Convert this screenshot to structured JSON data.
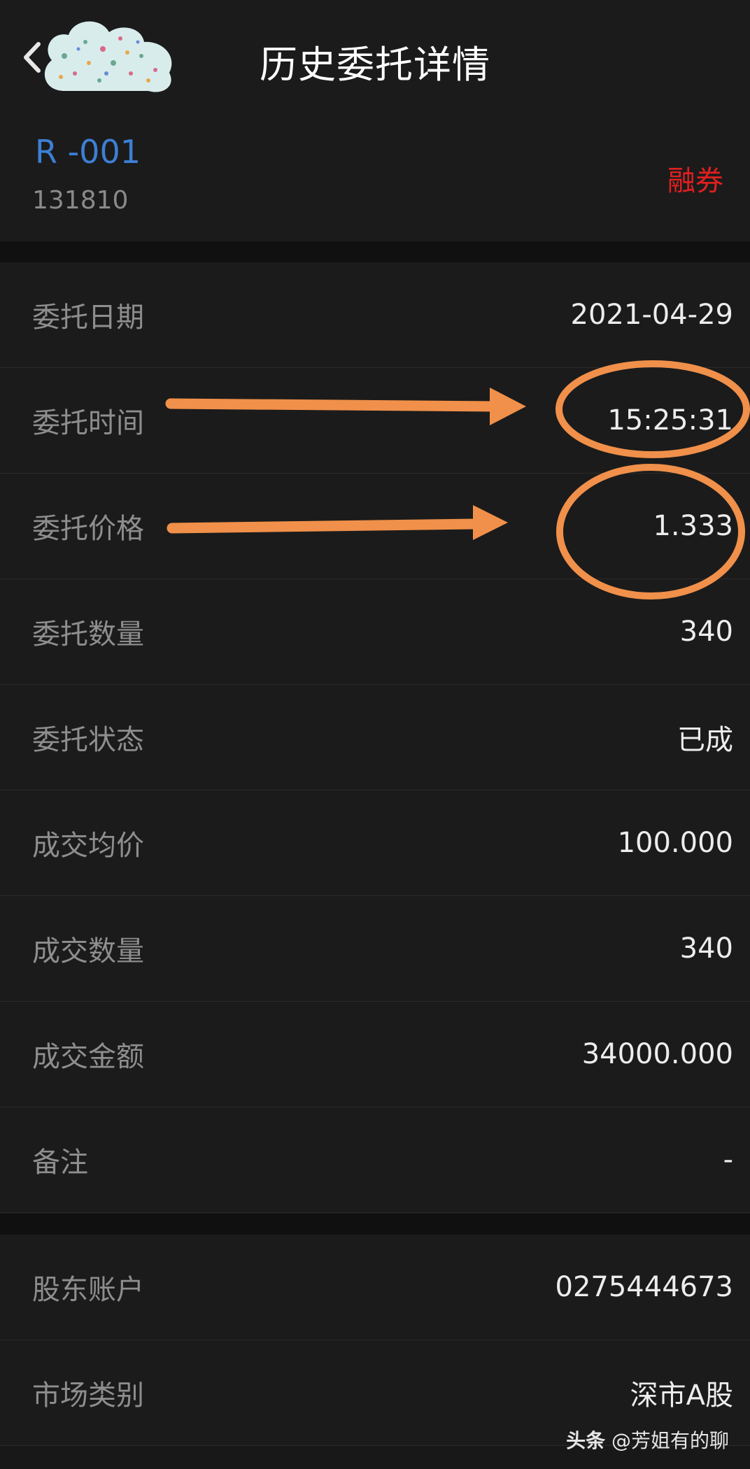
{
  "header": {
    "title": "历史委托详情",
    "back_icon": "chevron-left-icon"
  },
  "security": {
    "name": "R -001",
    "code": "131810",
    "trade_type": "融券"
  },
  "details": [
    {
      "label": "委托日期",
      "value": "2021-04-29"
    },
    {
      "label": "委托时间",
      "value": "15:25:31"
    },
    {
      "label": "委托价格",
      "value": "1.333"
    },
    {
      "label": "委托数量",
      "value": "340"
    },
    {
      "label": "委托状态",
      "value": "已成"
    },
    {
      "label": "成交均价",
      "value": "100.000"
    },
    {
      "label": "成交数量",
      "value": "340"
    },
    {
      "label": "成交金额",
      "value": "34000.000"
    },
    {
      "label": "备注",
      "value": "-"
    }
  ],
  "account": [
    {
      "label": "股东账户",
      "value": "0275444673"
    },
    {
      "label": "市场类别",
      "value": "深市A股"
    }
  ],
  "watermark": {
    "brand": "头条",
    "handle": "@芳姐有的聊"
  },
  "colors": {
    "accent_blue": "#3d7fd4",
    "trade_type_red": "#e02020",
    "annotation_orange": "#f0904a"
  }
}
